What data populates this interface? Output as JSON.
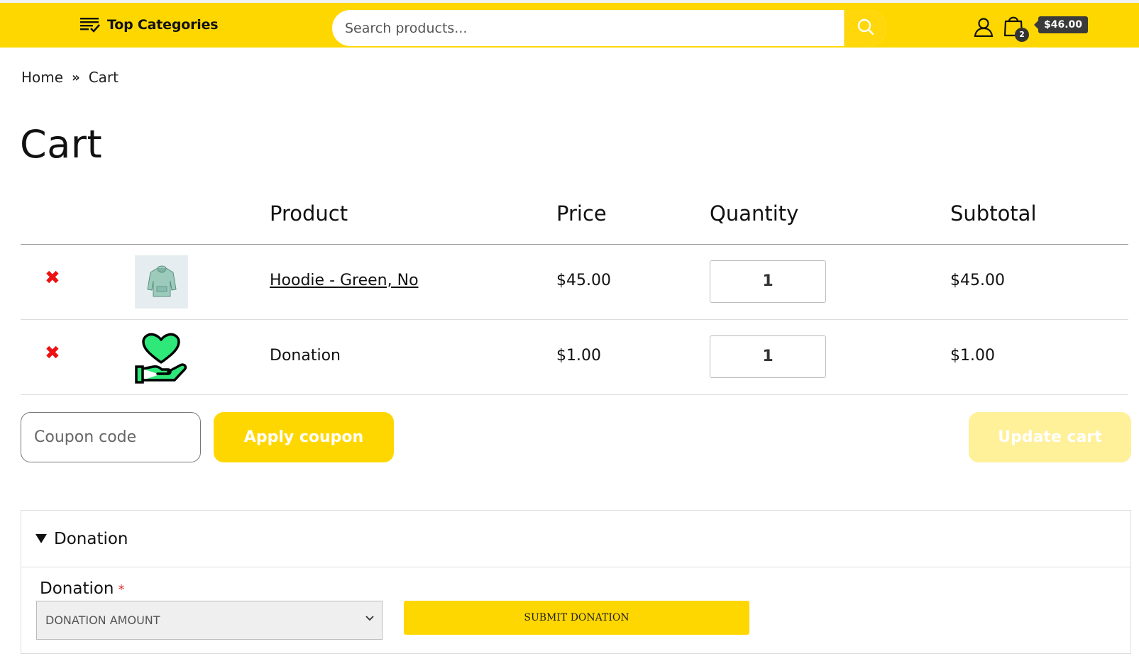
{
  "header": {
    "categories_label": "Top Categories",
    "search_placeholder": "Search products...",
    "cart_count": "2",
    "cart_total": "$46.00"
  },
  "breadcrumb": {
    "home": "Home",
    "separator": "»",
    "current": "Cart"
  },
  "page": {
    "title": "Cart"
  },
  "table": {
    "headers": {
      "product": "Product",
      "price": "Price",
      "quantity": "Quantity",
      "subtotal": "Subtotal"
    },
    "rows": [
      {
        "remove": "✖",
        "product": "Hoodie - Green, No",
        "price": "$45.00",
        "quantity": "1",
        "subtotal": "$45.00",
        "linked": true,
        "thumb": "hoodie-thumbnail"
      },
      {
        "remove": "✖",
        "product": "Donation",
        "price": "$1.00",
        "quantity": "1",
        "subtotal": "$1.00",
        "linked": false,
        "thumb": "donation-heart-hand-icon"
      }
    ]
  },
  "actions": {
    "coupon_placeholder": "Coupon code",
    "apply_label": "Apply coupon",
    "update_label": "Update cart"
  },
  "donation": {
    "summary": "Donation",
    "field_label": "Donation",
    "required_mark": "*",
    "select_value": "DONATION AMOUNT",
    "submit_label": "SUBMIT DONATION"
  },
  "colors": {
    "brand_yellow": "#ffd700",
    "update_disabled": "#fff09a",
    "remove_red": "#ee1111",
    "heart_green": "#2ee87a"
  }
}
